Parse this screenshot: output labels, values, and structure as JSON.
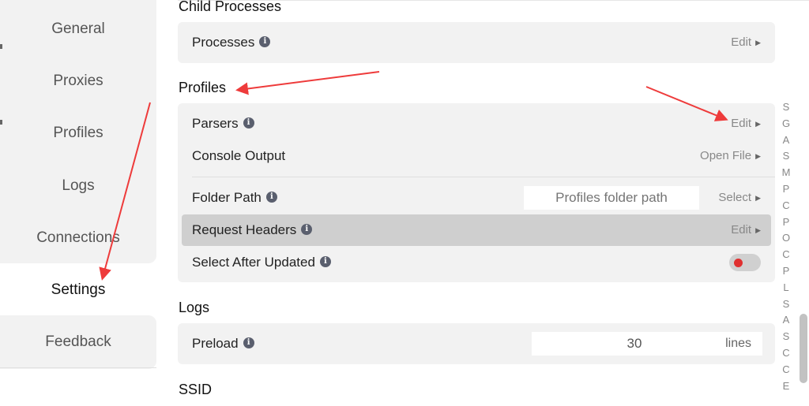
{
  "sidebar": {
    "items": [
      {
        "label": "General"
      },
      {
        "label": "Proxies"
      },
      {
        "label": "Profiles"
      },
      {
        "label": "Logs"
      },
      {
        "label": "Connections"
      },
      {
        "label": "Settings",
        "active": true
      },
      {
        "label": "Feedback"
      }
    ]
  },
  "sections": {
    "child_processes": {
      "title": "Child Processes",
      "processes": {
        "label": "Processes",
        "action": "Edit"
      }
    },
    "profiles": {
      "title": "Profiles",
      "parsers": {
        "label": "Parsers",
        "action": "Edit"
      },
      "console_output": {
        "label": "Console Output",
        "action": "Open File"
      },
      "folder_path": {
        "label": "Folder Path",
        "placeholder": "Profiles folder path",
        "action": "Select"
      },
      "request_headers": {
        "label": "Request Headers",
        "action": "Edit"
      },
      "select_after_updated": {
        "label": "Select After Updated",
        "enabled": false
      }
    },
    "logs": {
      "title": "Logs",
      "preload": {
        "label": "Preload",
        "value": "30",
        "unit": "lines"
      }
    },
    "ssid": {
      "title": "SSID"
    }
  },
  "index_letters": [
    "S",
    "G",
    "A",
    "S",
    "M",
    "P",
    "C",
    "P",
    "O",
    "C",
    "P",
    "L",
    "S",
    "A",
    "S",
    "C",
    "C",
    "E"
  ],
  "icons": {
    "info": "info-icon",
    "arrow": "caret-right-icon"
  },
  "colors": {
    "toggle_knob": "#e03030",
    "annotation_arrow": "#ee3b3b"
  }
}
